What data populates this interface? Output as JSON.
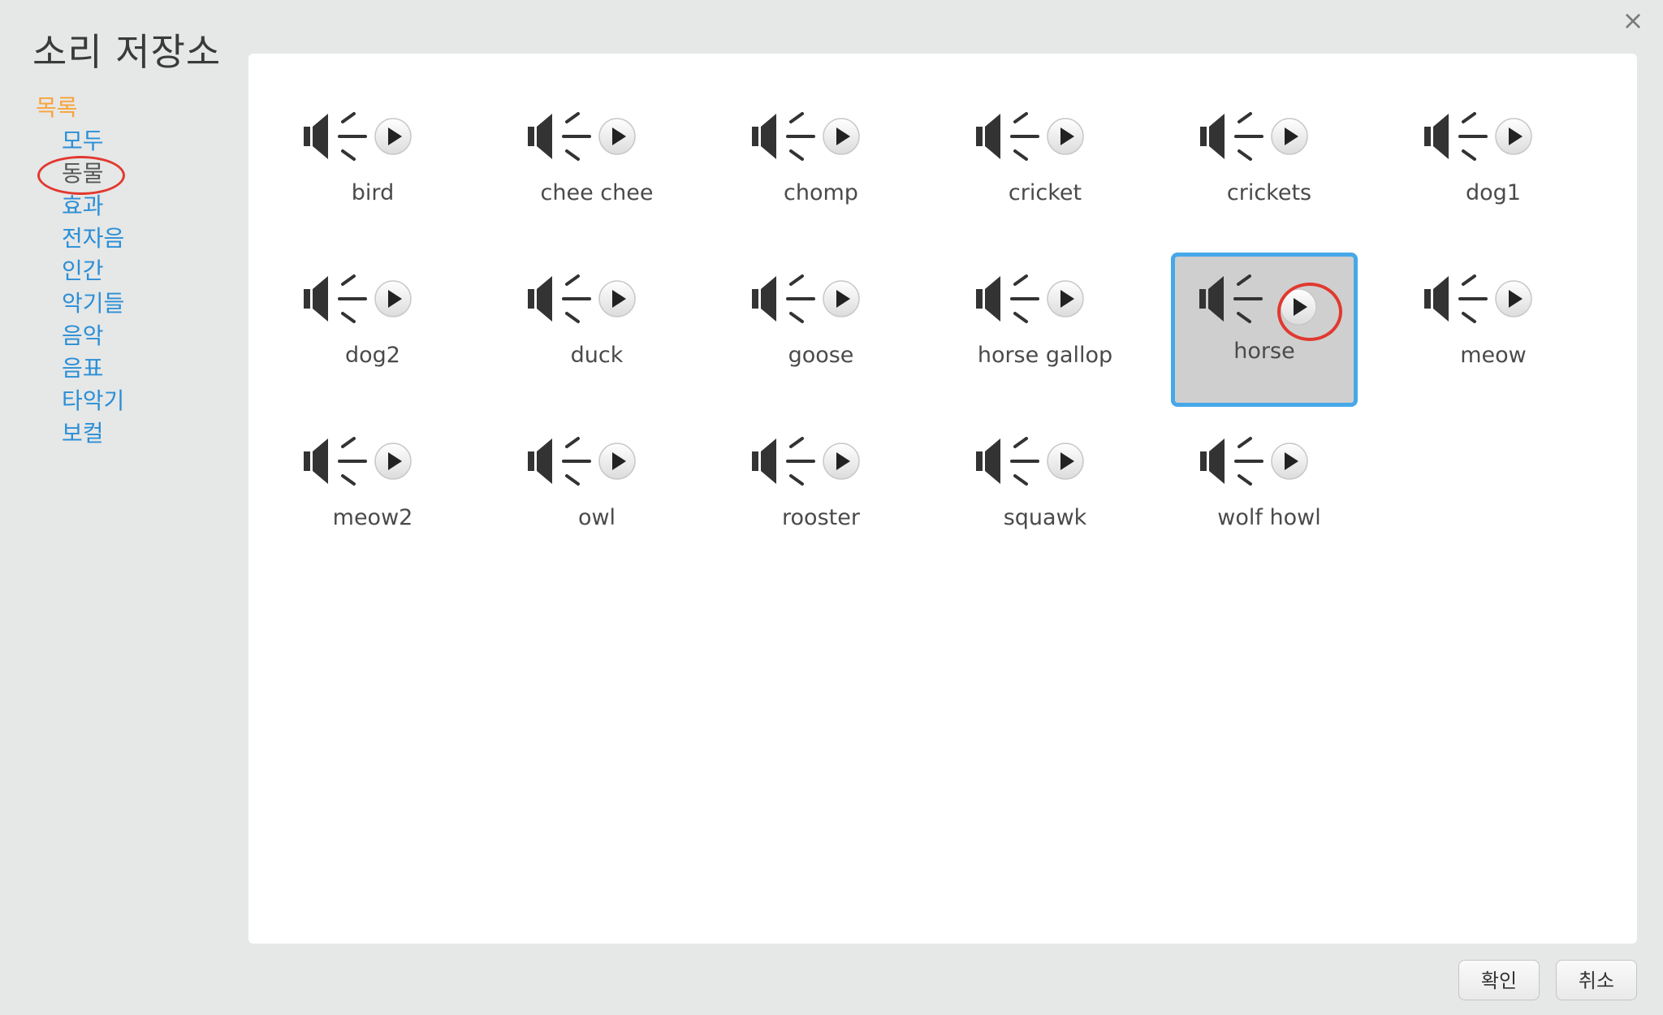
{
  "dialog": {
    "title": "소리 저장소",
    "close_glyph": "×"
  },
  "sidebar": {
    "heading": "목록",
    "items": [
      {
        "label": "모두",
        "selected": false
      },
      {
        "label": "동물",
        "selected": true
      },
      {
        "label": "효과",
        "selected": false
      },
      {
        "label": "전자음",
        "selected": false
      },
      {
        "label": "인간",
        "selected": false
      },
      {
        "label": "악기들",
        "selected": false
      },
      {
        "label": "음악",
        "selected": false
      },
      {
        "label": "음표",
        "selected": false
      },
      {
        "label": "타악기",
        "selected": false
      },
      {
        "label": "보컬",
        "selected": false
      }
    ]
  },
  "sounds": [
    {
      "label": "bird",
      "selected": false
    },
    {
      "label": "chee chee",
      "selected": false
    },
    {
      "label": "chomp",
      "selected": false
    },
    {
      "label": "cricket",
      "selected": false
    },
    {
      "label": "crickets",
      "selected": false
    },
    {
      "label": "dog1",
      "selected": false
    },
    {
      "label": "dog2",
      "selected": false
    },
    {
      "label": "duck",
      "selected": false
    },
    {
      "label": "goose",
      "selected": false
    },
    {
      "label": "horse gallop",
      "selected": false
    },
    {
      "label": "horse",
      "selected": true
    },
    {
      "label": "meow",
      "selected": false
    },
    {
      "label": "meow2",
      "selected": false
    },
    {
      "label": "owl",
      "selected": false
    },
    {
      "label": "rooster",
      "selected": false
    },
    {
      "label": "squawk",
      "selected": false
    },
    {
      "label": "wolf howl",
      "selected": false
    }
  ],
  "buttons": {
    "ok": "확인",
    "cancel": "취소"
  },
  "icons": {
    "sound": "speaker-icon",
    "play": "play-icon",
    "close": "close-icon"
  },
  "colors": {
    "accent_orange": "#f7a43b",
    "link_blue": "#2a8fd6",
    "selection_border": "#46a8e8",
    "annotation_red": "#e1392f"
  }
}
